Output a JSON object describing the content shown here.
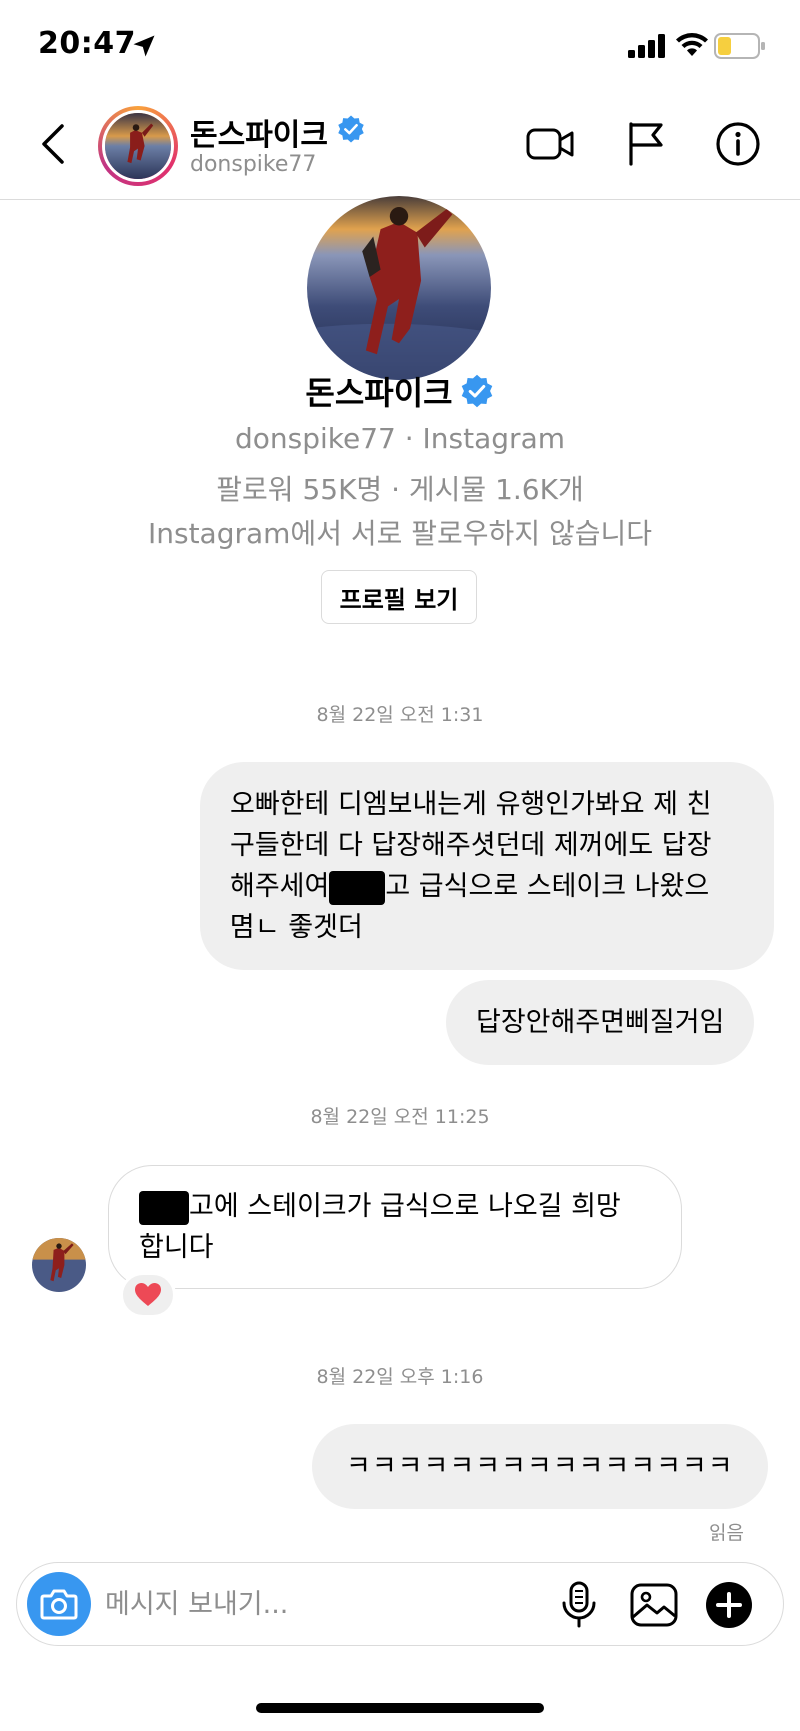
{
  "status_bar": {
    "time": "20:47"
  },
  "header": {
    "back_icon": "chevron-left-icon",
    "name": "돈스파이크",
    "handle": "donspike77",
    "actions": [
      "video-call-icon",
      "flag-icon",
      "info-icon"
    ]
  },
  "profile": {
    "name": "돈스파이크",
    "subtitle": "donspike77 · Instagram",
    "stats": "팔로워 55K명 · 게시물 1.6K개",
    "follow_status": "Instagram에서 서로 팔로우하지 않습니다",
    "view_profile_label": "프로필 보기"
  },
  "messages": {
    "ts1": "8월 22일 오전 1:31",
    "m1": {
      "line1": "오빠한테 디엠보내는게 유행인가봐요 제 친",
      "line2": "구들한데 다 답장해주셧던데 제꺼에도 답장",
      "line3_a": "해주세여",
      "line3_b": "고 급식으로 스테이크 나왔으",
      "line4": "몀ㄴ 좋겟더"
    },
    "m2": "답장안해주면삐질거임",
    "ts2": "8월 22일 오전 11:25",
    "m3": {
      "line1_b": "고에 스테이크가 급식으로 나오길 희망",
      "line2": "합니다"
    },
    "m3_reaction": "heart-icon",
    "ts3": "8월 22일 오후 1:16",
    "m4": "ㅋㅋㅋㅋㅋㅋㅋㅋㅋㅋㅋㅋㅋㅋㅋ",
    "read_receipt": "읽음"
  },
  "composer": {
    "placeholder": "메시지 보내기...",
    "icons": [
      "camera-icon",
      "microphone-icon",
      "gallery-icon",
      "plus-icon"
    ]
  },
  "colors": {
    "accent_blue": "#3897f0",
    "verified_blue": "#3897f0",
    "bubble_gray": "#efefef",
    "secondary_text": "#8e8e8e",
    "reaction_heart": "#ed4956"
  }
}
